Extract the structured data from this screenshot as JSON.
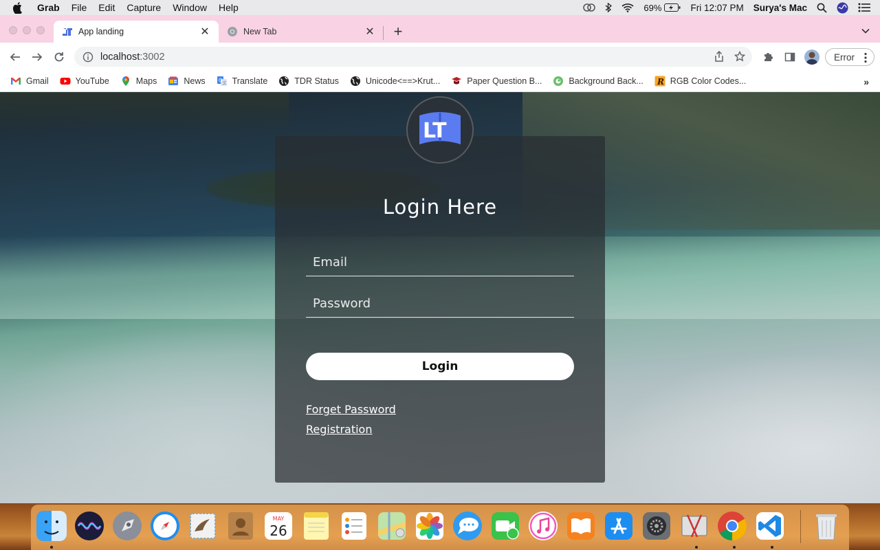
{
  "menubar": {
    "app": "Grab",
    "items": [
      "File",
      "Edit",
      "Capture",
      "Window",
      "Help"
    ],
    "battery": "69%",
    "clock": "Fri 12:07 PM",
    "user": "Surya's Mac"
  },
  "tabs": [
    {
      "title": "App landing",
      "active": true
    },
    {
      "title": "New Tab",
      "active": false
    }
  ],
  "toolbar": {
    "url_host": "localhost",
    "url_rest": ":3002",
    "error_label": "Error"
  },
  "bookmarks": [
    {
      "label": "Gmail",
      "icon": "gmail-icon"
    },
    {
      "label": "YouTube",
      "icon": "youtube-icon"
    },
    {
      "label": "Maps",
      "icon": "maps-icon"
    },
    {
      "label": "News",
      "icon": "news-icon"
    },
    {
      "label": "Translate",
      "icon": "translate-icon"
    },
    {
      "label": "TDR Status",
      "icon": "globe-icon"
    },
    {
      "label": "Unicode<==>Krut...",
      "icon": "globe-icon"
    },
    {
      "label": "Paper Question B...",
      "icon": "paper-icon"
    },
    {
      "label": "Background Back...",
      "icon": "background-icon"
    },
    {
      "label": "RGB Color Codes...",
      "icon": "rgb-icon"
    }
  ],
  "login": {
    "logo_text": "LT",
    "heading": "Login Here",
    "email_placeholder": "Email",
    "password_placeholder": "Password",
    "button": "Login",
    "forget_link": "Forget Password",
    "registration_link": "Registration"
  },
  "dock": {
    "calendar_month": "MAY",
    "calendar_day": "26"
  },
  "colors": {
    "tabstrip": "#f9d3e3",
    "card": "#282c30",
    "logo_blue": "#5a7cf0"
  }
}
